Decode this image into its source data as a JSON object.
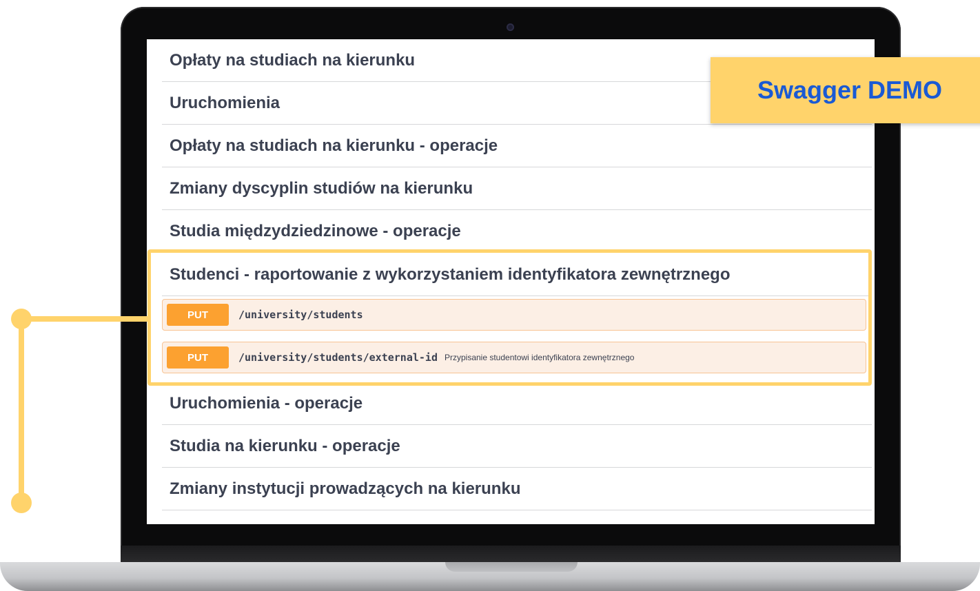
{
  "banner": {
    "label": "Swagger DEMO"
  },
  "sections": [
    "Opłaty na studiach na kierunku",
    "Uruchomienia",
    "Opłaty na studiach na kierunku - operacje",
    "Zmiany dyscyplin studiów na kierunku",
    "Studia międzydziedzinowe - operacje",
    "Studenci - raportowanie z wykorzystaniem identyfikatora zewnętrznego",
    "Uruchomienia - operacje",
    "Studia na kierunku - operacje",
    "Zmiany instytucji prowadzących na kierunku"
  ],
  "operations": [
    {
      "method": "PUT",
      "path": "/university/students",
      "summary": ""
    },
    {
      "method": "PUT",
      "path": "/university/students/external-id",
      "summary": "Przypisanie studentowi identyfikatora zewnętrznego"
    }
  ],
  "colors": {
    "put_method": "#fca130",
    "put_background": "#fcefe5",
    "highlight": "#ffd36b",
    "banner_text": "#1a5ad4"
  }
}
